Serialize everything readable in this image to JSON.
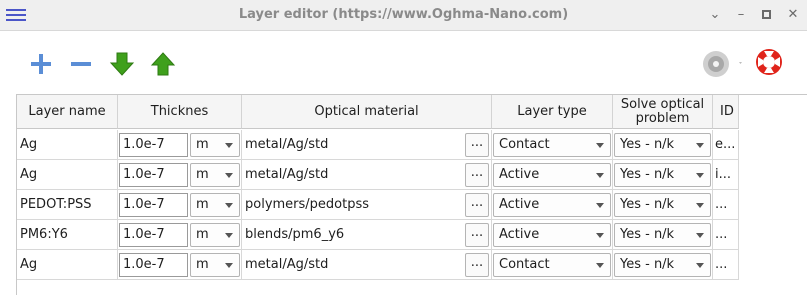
{
  "window": {
    "title": "Layer editor (https://www.Oghma-Nano.com)"
  },
  "toolbar": {
    "icons": [
      "add-icon",
      "remove-icon",
      "move-down-icon",
      "move-up-icon",
      "disk-icon",
      "help-lifebuoy-icon"
    ],
    "colors": {
      "add": "#5b8ed6",
      "arrows": "#3fa01c",
      "help": "#e0241b"
    }
  },
  "table": {
    "headers": [
      "Layer name",
      "Thicknes",
      "Optical material",
      "Layer type",
      "Solve optical problem",
      "ID"
    ],
    "rows": [
      {
        "name": "Ag",
        "thickness": "1.0e-7",
        "unit": "m",
        "material": "metal/Ag/std",
        "dots": "...",
        "type": "Contact",
        "solve": "Yes - n/k",
        "id": "e..."
      },
      {
        "name": "Ag",
        "thickness": "1.0e-7",
        "unit": "m",
        "material": "metal/Ag/std",
        "dots": "...",
        "type": "Active",
        "solve": "Yes - n/k",
        "id": "i..."
      },
      {
        "name": "PEDOT:PSS",
        "thickness": "1.0e-7",
        "unit": "m",
        "material": "polymers/pedotpss",
        "dots": "...",
        "type": "Active",
        "solve": "Yes - n/k",
        "id": "..."
      },
      {
        "name": "PM6:Y6",
        "thickness": "1.0e-7",
        "unit": "m",
        "material": "blends/pm6_y6",
        "dots": "...",
        "type": "Active",
        "solve": "Yes - n/k",
        "id": "..."
      },
      {
        "name": "Ag",
        "thickness": "1.0e-7",
        "unit": "m",
        "material": "metal/Ag/std",
        "dots": "...",
        "type": "Contact",
        "solve": "Yes - n/k",
        "id": "..."
      }
    ]
  }
}
